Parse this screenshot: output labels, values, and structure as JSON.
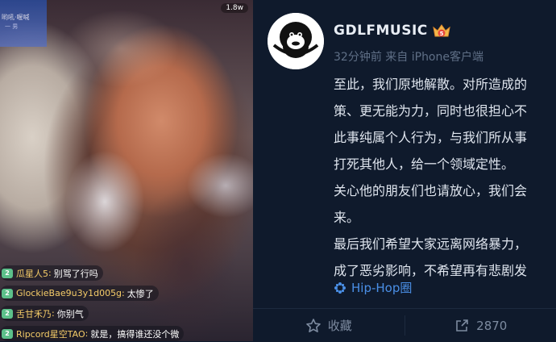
{
  "live": {
    "badge_title": "哟吼·喔喊",
    "badge_sub": "一 男",
    "viewer_count": "1.8w",
    "chat": [
      {
        "level": "2",
        "user": "瓜星人5",
        "message": "别骂了行吗"
      },
      {
        "level": "2",
        "user": "GlockieBae9u3y1d005g",
        "message": "太惨了"
      },
      {
        "level": "2",
        "user": "舌甘禾乃",
        "message": "你别气"
      },
      {
        "level": "2",
        "user": "Ripcord星空TAO",
        "message": "就是，搞得谁还没个微"
      }
    ]
  },
  "post": {
    "author": "GDLFMUSIC",
    "vip_level": "5",
    "time": "32分钟前",
    "source": "来自 iPhone客户端",
    "lines": [
      "至此，我们原地解散。对所造成的",
      "策、更无能为力，同时也很担心不",
      "此事纯属个人行为，与我们所从事",
      "打死其他人，给一个领域定性。",
      "关心他的朋友们也请放心，我们会",
      "来。",
      "最后我们希望大家远离网络暴力，",
      "成了恶劣影响，不希望再有悲剧发"
    ],
    "topic": "Hip-Hop圈",
    "favorite_label": "收藏",
    "repost_count": "2870"
  },
  "colors": {
    "background": "#0f1a2c",
    "text": "#dfe5ee",
    "muted": "#5f6f86",
    "link": "#4a8fe6",
    "chat_user": "#f5cc68",
    "level_badge": "#5cc08a"
  }
}
